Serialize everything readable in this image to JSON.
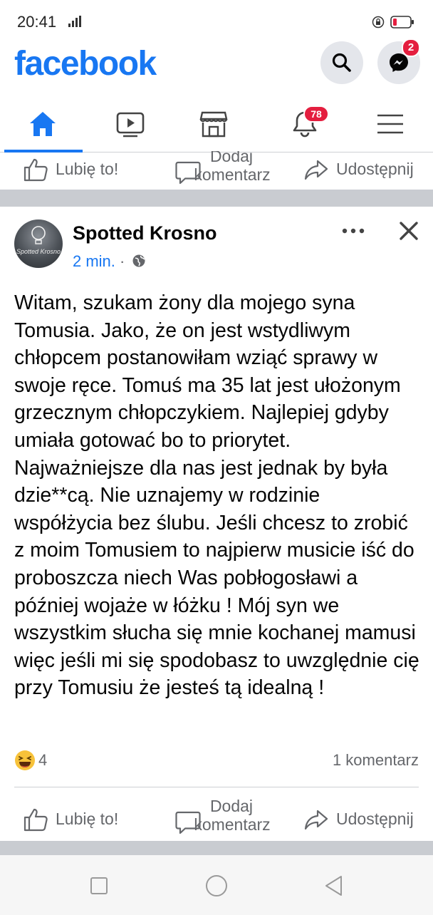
{
  "status_bar": {
    "time": "20:41",
    "network": "LTE"
  },
  "header": {
    "logo": "facebook",
    "messenger_badge": "2"
  },
  "tabs": {
    "notifications_badge": "78",
    "items": [
      "home-icon",
      "video-icon",
      "marketplace-icon",
      "notifications-icon",
      "menu-icon"
    ]
  },
  "actions": {
    "like": "Lubię to!",
    "comment_line1": "Dodaj",
    "comment_line2": "komentarz",
    "share": "Udostępnij"
  },
  "post": {
    "author": "Spotted Krosno",
    "avatar_text": "Spotted Krosno",
    "time": "2 min.",
    "separator": " · ",
    "body": "Witam, szukam żony dla mojego syna Tomusia. Jako, że on jest wstydliwym chłopcem postanowiłam wziąć sprawy w swoje ręce. Tomuś ma 35 lat jest ułożonym grzecznym chłopczykiem. Najlepiej gdyby umiała gotować bo to priorytet. Najważniejsze dla nas jest jednak by była dzie**cą. Nie uznajemy w rodzinie współżycia bez ślubu. Jeśli chcesz to zrobić z moim Tomusiem to najpierw musicie iść do proboszcza niech Was pobłogosławi a później wojaże w łóżku ! Mój syn we wszystkim słucha się mnie kochanej mamusi więc jeśli mi się spodobasz to uwzględnie cię przy Tomusiu że jesteś tą idealną !",
    "reaction_count": "4",
    "comments": "1 komentarz"
  },
  "colors": {
    "brand": "#1877f2",
    "badge": "#e41e3f",
    "muted": "#65676b"
  }
}
